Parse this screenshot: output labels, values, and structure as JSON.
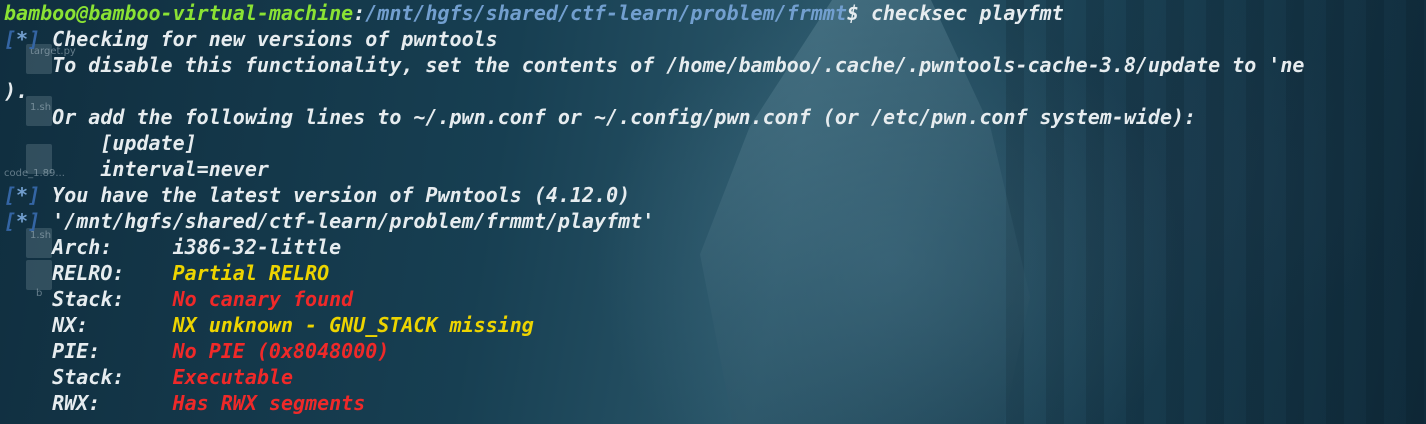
{
  "prompt": {
    "user_host": "bamboo@bamboo-virtual-machine",
    "path": "/mnt/hgfs/shared/ctf-learn/problem/frmmt",
    "symbol": "$",
    "command": " checksec playfmt"
  },
  "desktop_labels": [
    "target.py",
    "1.sh",
    "code_1.89...",
    "1.sh",
    "b"
  ],
  "output": {
    "info_marker_open": "[",
    "info_marker_star": "*",
    "info_marker_close": "]",
    "line1": " Checking for new versions of pwntools",
    "line2": "    To disable this functionality, set the contents of /home/bamboo/.cache/.pwntools-cache-3.8/update to 'ne",
    "line3": ").",
    "line4": "    Or add the following lines to ~/.pwn.conf or ~/.config/pwn.conf (or /etc/pwn.conf system-wide):",
    "line5": "        [update]",
    "line6": "        interval=never",
    "line7": " You have the latest version of Pwntools (4.12.0)",
    "line8": " '/mnt/hgfs/shared/ctf-learn/problem/frmmt/playfmt'"
  },
  "checksec": [
    {
      "key": "    Arch:     ",
      "value": "i386-32-little",
      "color": "white"
    },
    {
      "key": "    RELRO:    ",
      "value": "Partial RELRO",
      "color": "yellow"
    },
    {
      "key": "    Stack:    ",
      "value": "No canary found",
      "color": "red"
    },
    {
      "key": "    NX:       ",
      "value": "NX unknown - GNU_STACK missing",
      "color": "yellow"
    },
    {
      "key": "    PIE:      ",
      "value": "No PIE (0x8048000)",
      "color": "red"
    },
    {
      "key": "    Stack:    ",
      "value": "Executable",
      "color": "red"
    },
    {
      "key": "    RWX:      ",
      "value": "Has RWX segments",
      "color": "red"
    }
  ],
  "colors": {
    "user_host": "#8ae234",
    "path": "#729fcf",
    "text": "#e6ecef",
    "yellow": "#edd400",
    "red": "#ef2929"
  }
}
